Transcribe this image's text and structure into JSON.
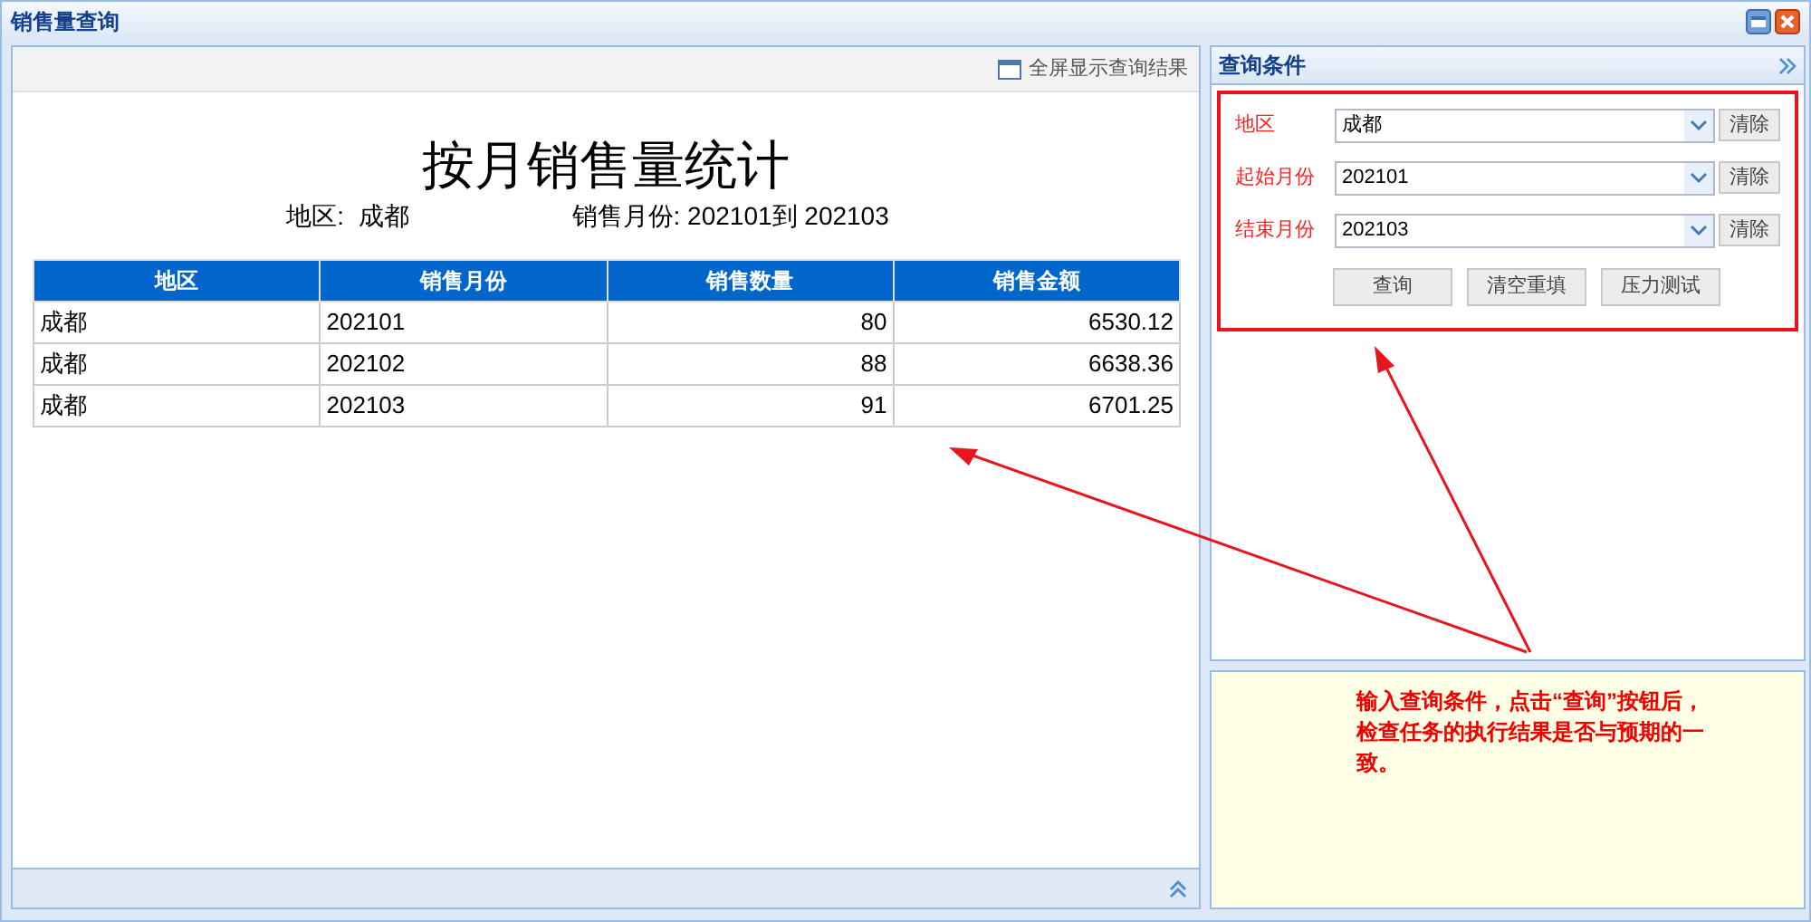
{
  "window": {
    "title": "销售量查询"
  },
  "toolbar": {
    "fullscreen_button": "全屏显示查询结果"
  },
  "report": {
    "title": "按月销售量统计",
    "region_label": "地区:  成都",
    "month_label": "销售月份: 202101到 202103"
  },
  "table": {
    "columns": [
      "地区",
      "销售月份",
      "销售数量",
      "销售金额"
    ],
    "rows": [
      [
        "成都",
        "202101",
        "80",
        "6530.12"
      ],
      [
        "成都",
        "202102",
        "88",
        "6638.36"
      ],
      [
        "成都",
        "202103",
        "91",
        "6701.25"
      ]
    ]
  },
  "query_panel": {
    "title": "查询条件",
    "fields": [
      {
        "label": "地区",
        "value": "成都",
        "clear": "清除"
      },
      {
        "label": "起始月份",
        "value": "202101",
        "clear": "清除"
      },
      {
        "label": "结束月份",
        "value": "202103",
        "clear": "清除"
      }
    ],
    "buttons": [
      "查询",
      "清空重填",
      "压力测试"
    ]
  },
  "note": "输入查询条件，点击“查询”按钮后，检查任务的执行结果是否与预期的一致。"
}
